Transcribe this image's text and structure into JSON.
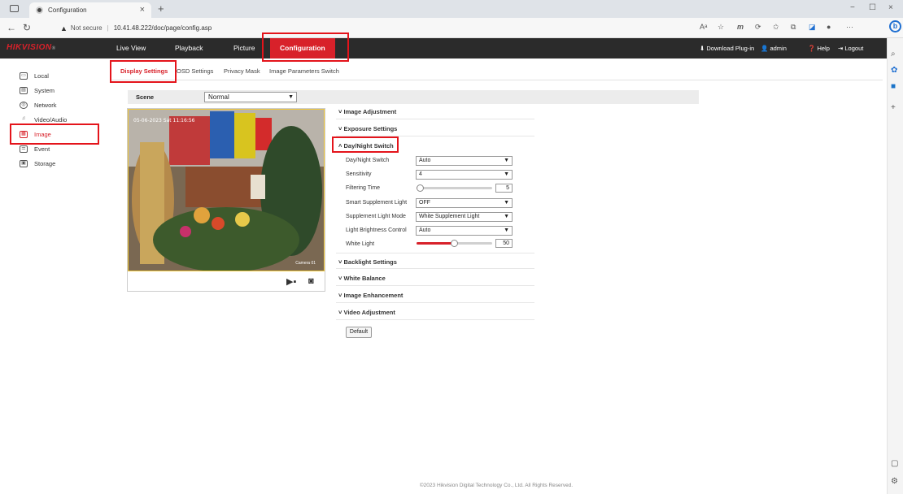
{
  "browser": {
    "tab_title": "Configuration",
    "tab_close": "×",
    "new_tab": "+",
    "security": "Not secure",
    "url": "10.41.48.222/doc/page/config.asp",
    "win_min": "−",
    "win_restore": "☐",
    "win_close": "×"
  },
  "header": {
    "logo": "HIKVISION",
    "logo_reg": "®",
    "nav": [
      "Live View",
      "Playback",
      "Picture",
      "Configuration"
    ],
    "download_plugin": "Download Plug-in",
    "user": "admin",
    "help": "Help",
    "logout": "Logout"
  },
  "sidebar": {
    "items": [
      {
        "label": "Local",
        "icon": "monitor-icon"
      },
      {
        "label": "System",
        "icon": "system-icon"
      },
      {
        "label": "Network",
        "icon": "globe-icon"
      },
      {
        "label": "Video/Audio",
        "icon": "video-audio-icon"
      },
      {
        "label": "Image",
        "icon": "image-icon"
      },
      {
        "label": "Event",
        "icon": "event-icon"
      },
      {
        "label": "Storage",
        "icon": "storage-icon"
      }
    ]
  },
  "subtabs": [
    "Display Settings",
    "OSD Settings",
    "Privacy Mask",
    "Image Parameters Switch"
  ],
  "scene": {
    "label": "Scene",
    "value": "Normal"
  },
  "video": {
    "osd_date": "05-06-2023 Sat 11:16:56",
    "camera_name": "Camera 01"
  },
  "sections": {
    "image_adjustment": "Image Adjustment",
    "exposure_settings": "Exposure Settings",
    "day_night_switch": "Day/Night Switch",
    "backlight_settings": "Backlight Settings",
    "white_balance": "White Balance",
    "image_enhancement": "Image Enhancement",
    "video_adjustment": "Video Adjustment"
  },
  "day_night": {
    "switch_label": "Day/Night Switch",
    "switch_value": "Auto",
    "sensitivity_label": "Sensitivity",
    "sensitivity_value": "4",
    "filtering_label": "Filtering Time",
    "filtering_value": "5",
    "filtering_fraction": 0.0,
    "smart_label": "Smart Supplement Light",
    "smart_value": "OFF",
    "mode_label": "Supplement Light Mode",
    "mode_value": "White Supplement Light",
    "brightness_label": "Light Brightness Control",
    "brightness_value": "Auto",
    "white_light_label": "White Light",
    "white_light_value": "50",
    "white_light_fraction": 0.5
  },
  "default_button": "Default",
  "footer": "©2023 Hikvision Digital Technology Co., Ltd. All Rights Reserved.",
  "colors": {
    "brand_red": "#d8212a",
    "header_bg": "#2b2b2b"
  }
}
